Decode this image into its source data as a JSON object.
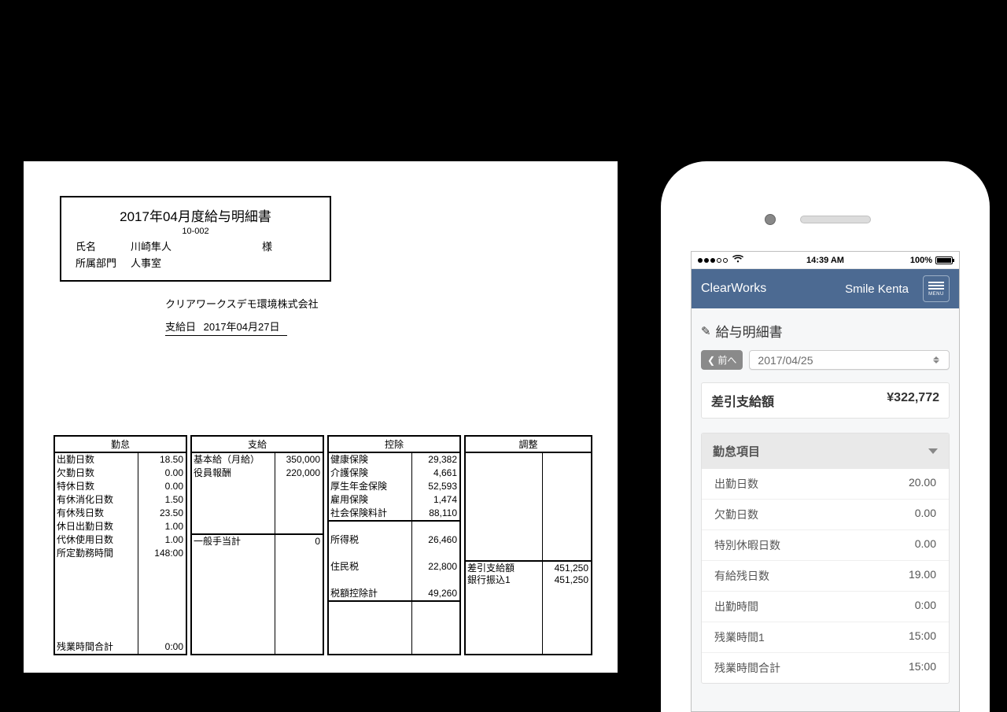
{
  "paper": {
    "header": {
      "title": "2017年04月度給与明細書",
      "code": "10-002",
      "name_label": "氏名",
      "name_value": "川崎隼人",
      "name_suffix": "様",
      "dept_label": "所属部門",
      "dept_value": "人事室"
    },
    "company": "クリアワークスデモ環境株式会社",
    "payday_label": "支給日",
    "payday_value": "2017年04月27日",
    "tables": {
      "kintai": {
        "title": "勤怠",
        "rows": [
          {
            "k": "出勤日数",
            "v": "18.50"
          },
          {
            "k": "欠勤日数",
            "v": "0.00"
          },
          {
            "k": "特休日数",
            "v": "0.00"
          },
          {
            "k": "有休消化日数",
            "v": "1.50"
          },
          {
            "k": "有休残日数",
            "v": "23.50"
          },
          {
            "k": "休日出勤日数",
            "v": "1.00"
          },
          {
            "k": "代休使用日数",
            "v": "1.00"
          },
          {
            "k": "所定勤務時間",
            "v": "148:00"
          },
          {
            "k": "",
            "v": ""
          },
          {
            "k": "",
            "v": ""
          },
          {
            "k": "",
            "v": ""
          },
          {
            "k": "",
            "v": ""
          },
          {
            "k": "",
            "v": ""
          },
          {
            "k": "",
            "v": ""
          },
          {
            "k": "残業時間合計",
            "v": "0:00"
          }
        ]
      },
      "sikyu": {
        "title": "支給",
        "rows": [
          {
            "k": "基本給（月給）",
            "v": "350,000"
          },
          {
            "k": "役員報酬",
            "v": "220,000"
          },
          {
            "k": "",
            "v": ""
          },
          {
            "k": "",
            "v": ""
          },
          {
            "k": "",
            "v": ""
          },
          {
            "k": "",
            "v": ""
          },
          {
            "k": "一般手当計",
            "v": "0",
            "sep": true
          },
          {
            "k": "",
            "v": ""
          },
          {
            "k": "",
            "v": ""
          },
          {
            "k": "",
            "v": ""
          },
          {
            "k": "",
            "v": ""
          },
          {
            "k": "",
            "v": ""
          },
          {
            "k": "",
            "v": ""
          },
          {
            "k": "",
            "v": ""
          },
          {
            "k": "",
            "v": ""
          }
        ]
      },
      "kojo": {
        "title": "控除",
        "rows": [
          {
            "k": "健康保険",
            "v": "29,382"
          },
          {
            "k": "介護保険",
            "v": "4,661"
          },
          {
            "k": "厚生年金保険",
            "v": "52,593"
          },
          {
            "k": "雇用保険",
            "v": "1,474"
          },
          {
            "k": "社会保険料計",
            "v": "88,110"
          },
          {
            "k": "",
            "v": "",
            "sep": true
          },
          {
            "k": "所得税",
            "v": "26,460"
          },
          {
            "k": "",
            "v": ""
          },
          {
            "k": "住民税",
            "v": "22,800"
          },
          {
            "k": "",
            "v": ""
          },
          {
            "k": "税額控除計",
            "v": "49,260"
          },
          {
            "k": "",
            "v": "",
            "sep": true
          },
          {
            "k": "",
            "v": ""
          },
          {
            "k": "",
            "v": ""
          },
          {
            "k": "",
            "v": ""
          }
        ]
      },
      "chosei": {
        "title": "調整",
        "rows": [
          {
            "k": "",
            "v": ""
          },
          {
            "k": "",
            "v": ""
          },
          {
            "k": "",
            "v": ""
          },
          {
            "k": "",
            "v": ""
          },
          {
            "k": "",
            "v": ""
          },
          {
            "k": "",
            "v": ""
          },
          {
            "k": "",
            "v": ""
          },
          {
            "k": "",
            "v": ""
          },
          {
            "k": "差引支給額",
            "v": "451,250",
            "sep": true
          },
          {
            "k": "銀行振込1",
            "v": "451,250"
          },
          {
            "k": "",
            "v": ""
          },
          {
            "k": "",
            "v": ""
          },
          {
            "k": "",
            "v": ""
          },
          {
            "k": "",
            "v": ""
          },
          {
            "k": "",
            "v": ""
          }
        ]
      }
    }
  },
  "phone": {
    "status": {
      "time": "14:39 AM",
      "battery_pct": "100%"
    },
    "appbar": {
      "brand": "ClearWorks",
      "user": "Smile Kenta",
      "menu_label": "MENU"
    },
    "page_title": "給与明細書",
    "prev_label": "前へ",
    "date_value": "2017/04/25",
    "net_label": "差引支給額",
    "net_value": "¥322,772",
    "section_title": "勤怠項目",
    "section_rows": [
      {
        "k": "出勤日数",
        "v": "20.00"
      },
      {
        "k": "欠勤日数",
        "v": "0.00"
      },
      {
        "k": "特別休暇日数",
        "v": "0.00"
      },
      {
        "k": "有給残日数",
        "v": "19.00"
      },
      {
        "k": "出勤時間",
        "v": "0:00"
      },
      {
        "k": "残業時間1",
        "v": "15:00"
      },
      {
        "k": "残業時間合計",
        "v": "15:00"
      }
    ]
  }
}
